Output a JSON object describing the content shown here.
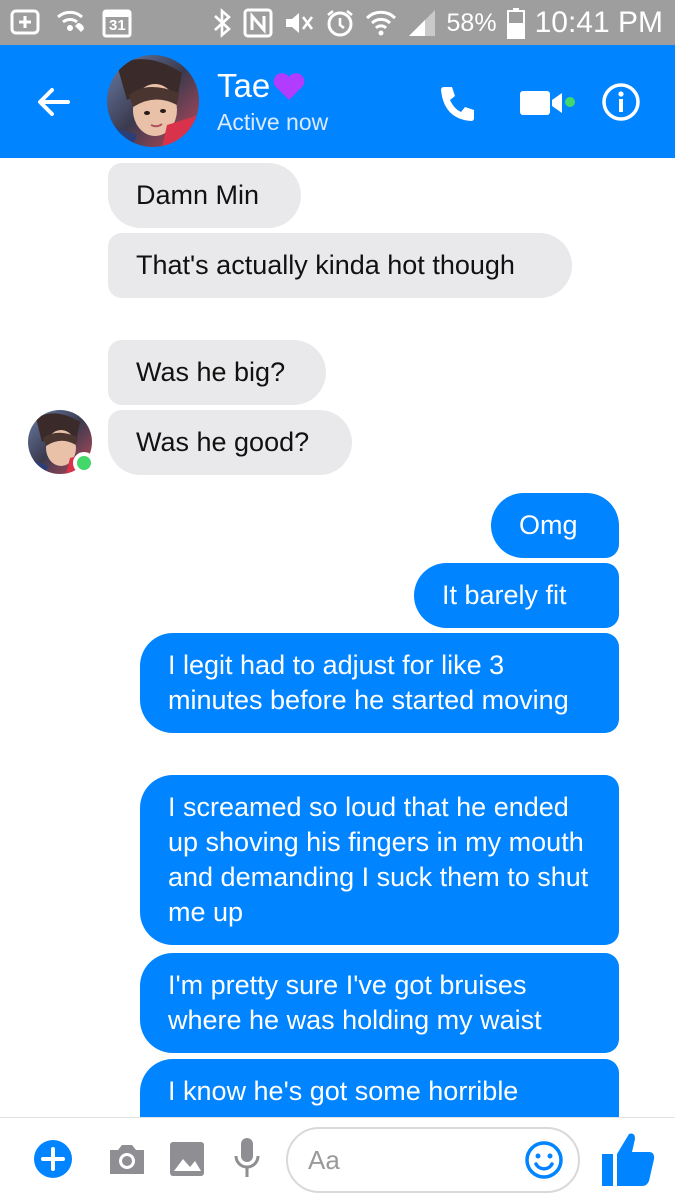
{
  "status_bar": {
    "calendar_day": "31",
    "battery": "58%",
    "time": "10:41 PM",
    "icons": [
      "plus-box-icon",
      "wifi-call-icon",
      "calendar-icon",
      "bluetooth-icon",
      "nfc-icon",
      "mute-icon",
      "alarm-icon",
      "wifi-icon",
      "signal-icon",
      "battery-icon"
    ]
  },
  "header": {
    "name": "Tae",
    "name_emoji": "💜",
    "status": "Active now",
    "colors": {
      "background": "#0084ff",
      "active": "#44d86b"
    }
  },
  "messages": [
    {
      "side": "in",
      "text": "Damn Min"
    },
    {
      "side": "in",
      "text": "That's actually kinda hot though"
    },
    {
      "side": "in",
      "text": "Was he big?"
    },
    {
      "side": "in",
      "text": "Was he good?"
    },
    {
      "side": "out",
      "text": "Omg"
    },
    {
      "side": "out",
      "text": "It barely fit"
    },
    {
      "side": "out",
      "text": "I legit had to adjust for like 3 minutes before he started moving"
    },
    {
      "side": "out",
      "text": "I screamed so loud that he ended up shoving his fingers in my mouth and demanding I suck them to shut me up"
    },
    {
      "side": "out",
      "text": "I'm pretty sure I've got bruises where he was holding my waist"
    },
    {
      "side": "out",
      "text": "I know he's got some horrible"
    }
  ],
  "composer": {
    "placeholder": "Aa",
    "icons": [
      "plus-icon",
      "camera-icon",
      "image-icon",
      "mic-icon",
      "emoji-icon",
      "like-icon"
    ]
  },
  "colors": {
    "incoming_bubble": "#e9e9eb",
    "outgoing_bubble": "#0084ff",
    "status_bar": "#9e9e9e"
  }
}
